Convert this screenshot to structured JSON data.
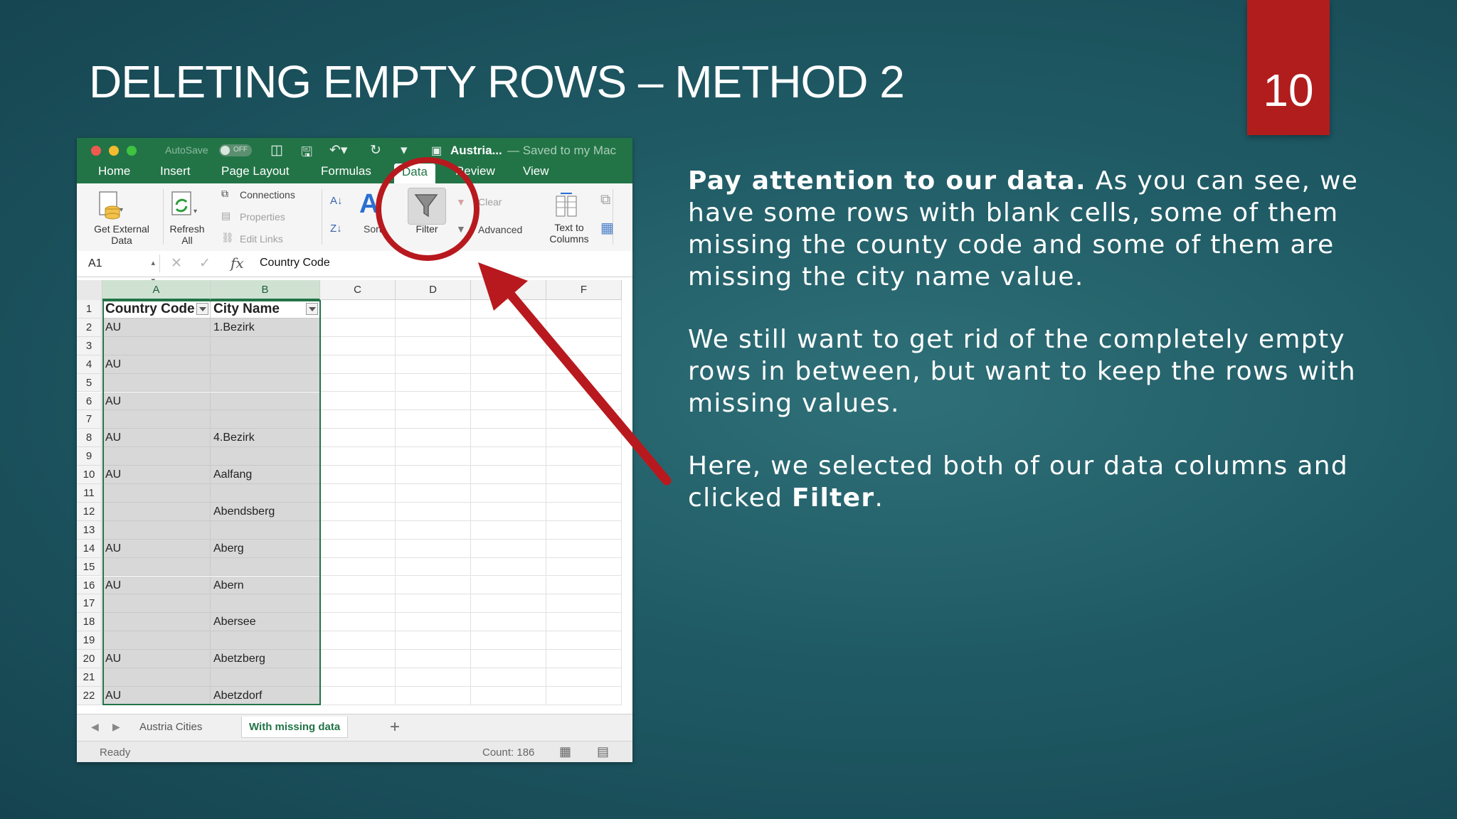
{
  "slide": {
    "title": "DELETING EMPTY ROWS – METHOD 2",
    "page_number": "10",
    "paragraphs": [
      {
        "bold": "Pay attention to our data.",
        "text": " As you can see, we have some rows with blank cells, some of them missing the county code and some of them are missing the city name value."
      },
      {
        "bold": "",
        "text": "We still want to get rid of the completely empty rows in between, but want to keep the rows with missing values."
      },
      {
        "bold": "",
        "text": "Here, we selected both of our data columns and clicked ",
        "bold_tail": "Filter",
        "tail": "."
      }
    ],
    "accent_color": "#b11d1d"
  },
  "excel": {
    "titlebar": {
      "autosave": "AutoSave",
      "toggle": "OFF",
      "doc_name": "Austria...",
      "doc_status": "— Saved to my Mac"
    },
    "tabs": [
      "Home",
      "Insert",
      "Page Layout",
      "Formulas",
      "Data",
      "Review",
      "View"
    ],
    "active_tab": "Data",
    "ribbon": {
      "get_external_data": "Get External\nData",
      "refresh_all": "Refresh\nAll",
      "connections": "Connections",
      "properties": "Properties",
      "edit_links": "Edit Links",
      "sort": "Sort",
      "filter": "Filter",
      "clear": "Clear",
      "advanced": "Advanced",
      "text_to_columns": "Text to\nColumns"
    },
    "formula_bar": {
      "name_box": "A1",
      "fx": "fx",
      "content": "Country Code"
    },
    "columns": [
      "A",
      "B",
      "C",
      "D",
      "E",
      "F"
    ],
    "rows": [
      {
        "n": "1",
        "a": "Country Code",
        "b": "City Name"
      },
      {
        "n": "2",
        "a": "AU",
        "b": "1.Bezirk"
      },
      {
        "n": "3",
        "a": "",
        "b": ""
      },
      {
        "n": "4",
        "a": "AU",
        "b": ""
      },
      {
        "n": "5",
        "a": "",
        "b": ""
      },
      {
        "n": "6",
        "a": "AU",
        "b": ""
      },
      {
        "n": "7",
        "a": "",
        "b": ""
      },
      {
        "n": "8",
        "a": "AU",
        "b": "4.Bezirk"
      },
      {
        "n": "9",
        "a": "",
        "b": ""
      },
      {
        "n": "10",
        "a": "AU",
        "b": "Aalfang"
      },
      {
        "n": "11",
        "a": "",
        "b": ""
      },
      {
        "n": "12",
        "a": "",
        "b": "Abendsberg"
      },
      {
        "n": "13",
        "a": "",
        "b": ""
      },
      {
        "n": "14",
        "a": "AU",
        "b": "Aberg"
      },
      {
        "n": "15",
        "a": "",
        "b": ""
      },
      {
        "n": "16",
        "a": "AU",
        "b": "Abern"
      },
      {
        "n": "17",
        "a": "",
        "b": ""
      },
      {
        "n": "18",
        "a": "",
        "b": "Abersee"
      },
      {
        "n": "19",
        "a": "",
        "b": ""
      },
      {
        "n": "20",
        "a": "AU",
        "b": "Abetzberg"
      },
      {
        "n": "21",
        "a": "",
        "b": ""
      },
      {
        "n": "22",
        "a": "AU",
        "b": "Abetzdorf"
      }
    ],
    "sheet_tabs": [
      "Austria Cities",
      "With missing data"
    ],
    "active_sheet": "With missing data",
    "add_sheet": "+",
    "status": {
      "ready": "Ready",
      "count": "Count: 186"
    },
    "theme_color": "#227447"
  }
}
